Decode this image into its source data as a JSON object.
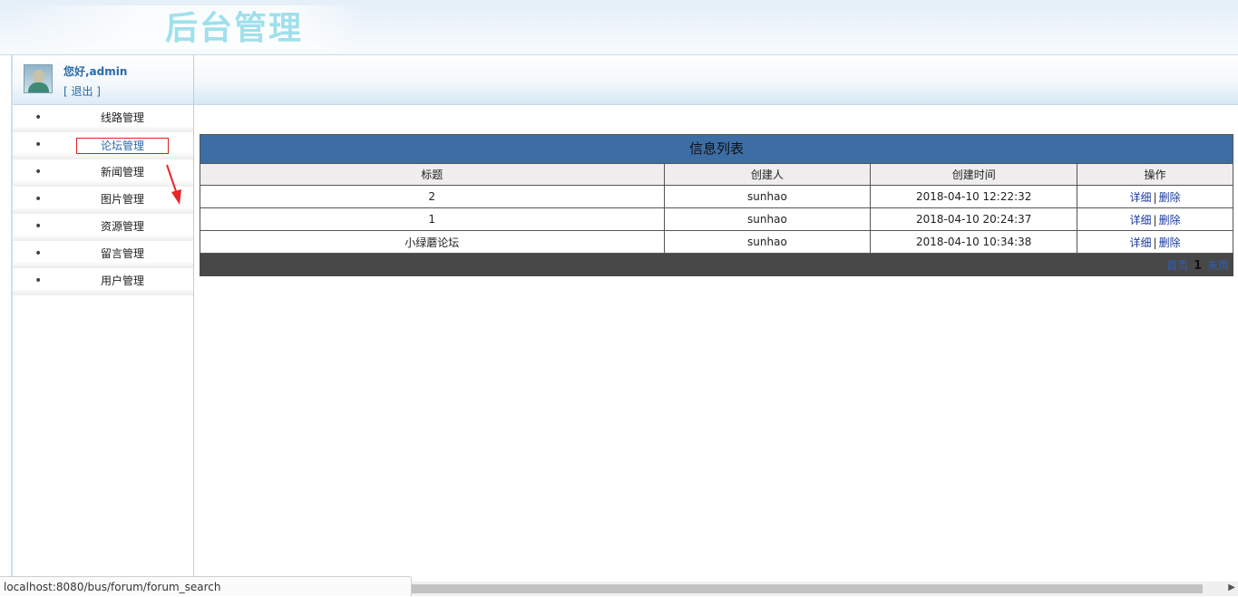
{
  "banner": {
    "title": "后台管理"
  },
  "user": {
    "greeting": "您好,admin",
    "logout": "[ 退出 ]",
    "avatar_icon": "user-avatar-icon"
  },
  "menu": {
    "items": [
      {
        "label": "线路管理"
      },
      {
        "label": "论坛管理",
        "active": true
      },
      {
        "label": "新闻管理"
      },
      {
        "label": "图片管理"
      },
      {
        "label": "资源管理"
      },
      {
        "label": "留言管理"
      },
      {
        "label": "用户管理"
      }
    ],
    "bullet": "•"
  },
  "table": {
    "title": "信息列表",
    "headers": [
      "标题",
      "创建人",
      "创建时间",
      "操作"
    ],
    "rows": [
      {
        "title": "2",
        "creator": "sunhao",
        "created": "2018-04-10 12:22:32",
        "detail": "详细",
        "sep": "|",
        "delete": "删除"
      },
      {
        "title": "1",
        "creator": "sunhao",
        "created": "2018-04-10 20:24:37",
        "detail": "详细",
        "sep": "|",
        "delete": "删除"
      },
      {
        "title": "小绿蘑论坛",
        "creator": "sunhao",
        "created": "2018-04-10 10:34:38",
        "detail": "详细",
        "sep": "|",
        "delete": "删除"
      }
    ],
    "pager": {
      "first": "首页",
      "current": "1",
      "last": "末页"
    }
  },
  "status": {
    "url": "localhost:8080/bus/forum/forum_search"
  },
  "colors": {
    "title_bar": "#3c6da5",
    "footer_bar": "#484848",
    "accent": "#2a6aa8",
    "highlight_border": "#e02020"
  }
}
